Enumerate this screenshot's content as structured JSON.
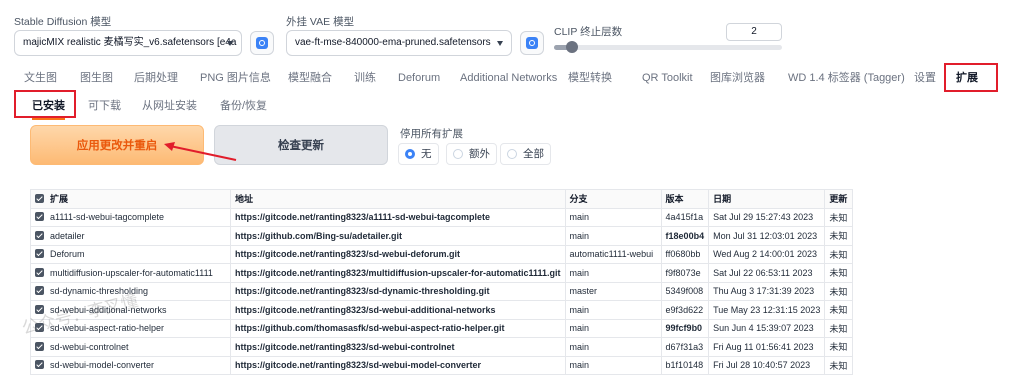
{
  "header": {
    "sd_model_label": "Stable Diffusion 模型",
    "sd_model_value": "majicMIX realistic 麦橘写实_v6.safetensors [e4a",
    "vae_label": "外挂 VAE 模型",
    "vae_value": "vae-ft-mse-840000-ema-pruned.safetensors",
    "clip_label": "CLIP 终止层数",
    "clip_value": "2",
    "clip_slider_fraction": 0.08,
    "icons": {
      "refresh": "refresh-icon",
      "dropdown": "chevron-down-icon"
    }
  },
  "main_tabs": [
    "文生图",
    "图生图",
    "后期处理",
    "PNG 图片信息",
    "模型融合",
    "训练",
    "Deforum",
    "Additional Networks",
    "模型转换",
    "QR Toolkit",
    "图库浏览器",
    "WD 1.4 标签器 (Tagger)",
    "设置",
    "扩展"
  ],
  "sub_tabs": [
    "已安装",
    "可下载",
    "从网址安装",
    "备份/恢复"
  ],
  "actions": {
    "apply": "应用更改并重启",
    "check": "检查更新",
    "disable_label": "停用所有扩展",
    "options": [
      "无",
      "额外",
      "全部"
    ],
    "selected_option": "无"
  },
  "table": {
    "headers": [
      "扩展",
      "地址",
      "分支",
      "版本",
      "日期",
      "更新"
    ],
    "rows": [
      {
        "name": "a1111-sd-webui-tagcomplete",
        "url": "https://gitcode.net/ranting8323/a1111-sd-webui-tagcomplete",
        "branch": "main",
        "version": "4a415f1a",
        "date": "Sat Jul 29 15:27:43 2023",
        "update": "未知"
      },
      {
        "name": "adetailer",
        "url": "https://github.com/Bing-su/adetailer.git",
        "branch": "main",
        "version": "f18e00b4",
        "date": "Mon Jul 31 12:03:01 2023",
        "update": "未知"
      },
      {
        "name": "Deforum",
        "url": "https://gitcode.net/ranting8323/sd-webui-deforum.git",
        "branch": "automatic1111-webui",
        "version": "ff0680bb",
        "date": "Wed Aug 2 14:00:01 2023",
        "update": "未知"
      },
      {
        "name": "multidiffusion-upscaler-for-automatic1111",
        "url": "https://gitcode.net/ranting8323/multidiffusion-upscaler-for-automatic1111.git",
        "branch": "main",
        "version": "f9f8073e",
        "date": "Sat Jul 22 06:53:11 2023",
        "update": "未知"
      },
      {
        "name": "sd-dynamic-thresholding",
        "url": "https://gitcode.net/ranting8323/sd-dynamic-thresholding.git",
        "branch": "master",
        "version": "5349f008",
        "date": "Thu Aug 3 17:31:39 2023",
        "update": "未知"
      },
      {
        "name": "sd-webui-additional-networks",
        "url": "https://gitcode.net/ranting8323/sd-webui-additional-networks",
        "branch": "main",
        "version": "e9f3d622",
        "date": "Tue May 23 12:31:15 2023",
        "update": "未知"
      },
      {
        "name": "sd-webui-aspect-ratio-helper",
        "url": "https://github.com/thomasasfk/sd-webui-aspect-ratio-helper.git",
        "branch": "main",
        "version": "99fcf9b0",
        "date": "Sun Jun 4 15:39:07 2023",
        "update": "未知"
      },
      {
        "name": "sd-webui-controlnet",
        "url": "https://gitcode.net/ranting8323/sd-webui-controlnet",
        "branch": "main",
        "version": "d67f31a3",
        "date": "Fri Aug 11 01:56:41 2023",
        "update": "未知"
      },
      {
        "name": "sd-webui-model-converter",
        "url": "https://gitcode.net/ranting8323/sd-webui-model-converter",
        "branch": "main",
        "version": "b1f10148",
        "date": "Fri Jul 28 10:40:57 2023",
        "update": "未知"
      }
    ]
  },
  "watermark": "公众号：李叉懂",
  "accent_colors": {
    "annotation_red": "#e11d2b",
    "apply_orange": "#ea580c",
    "radio_blue": "#3b82f6"
  }
}
